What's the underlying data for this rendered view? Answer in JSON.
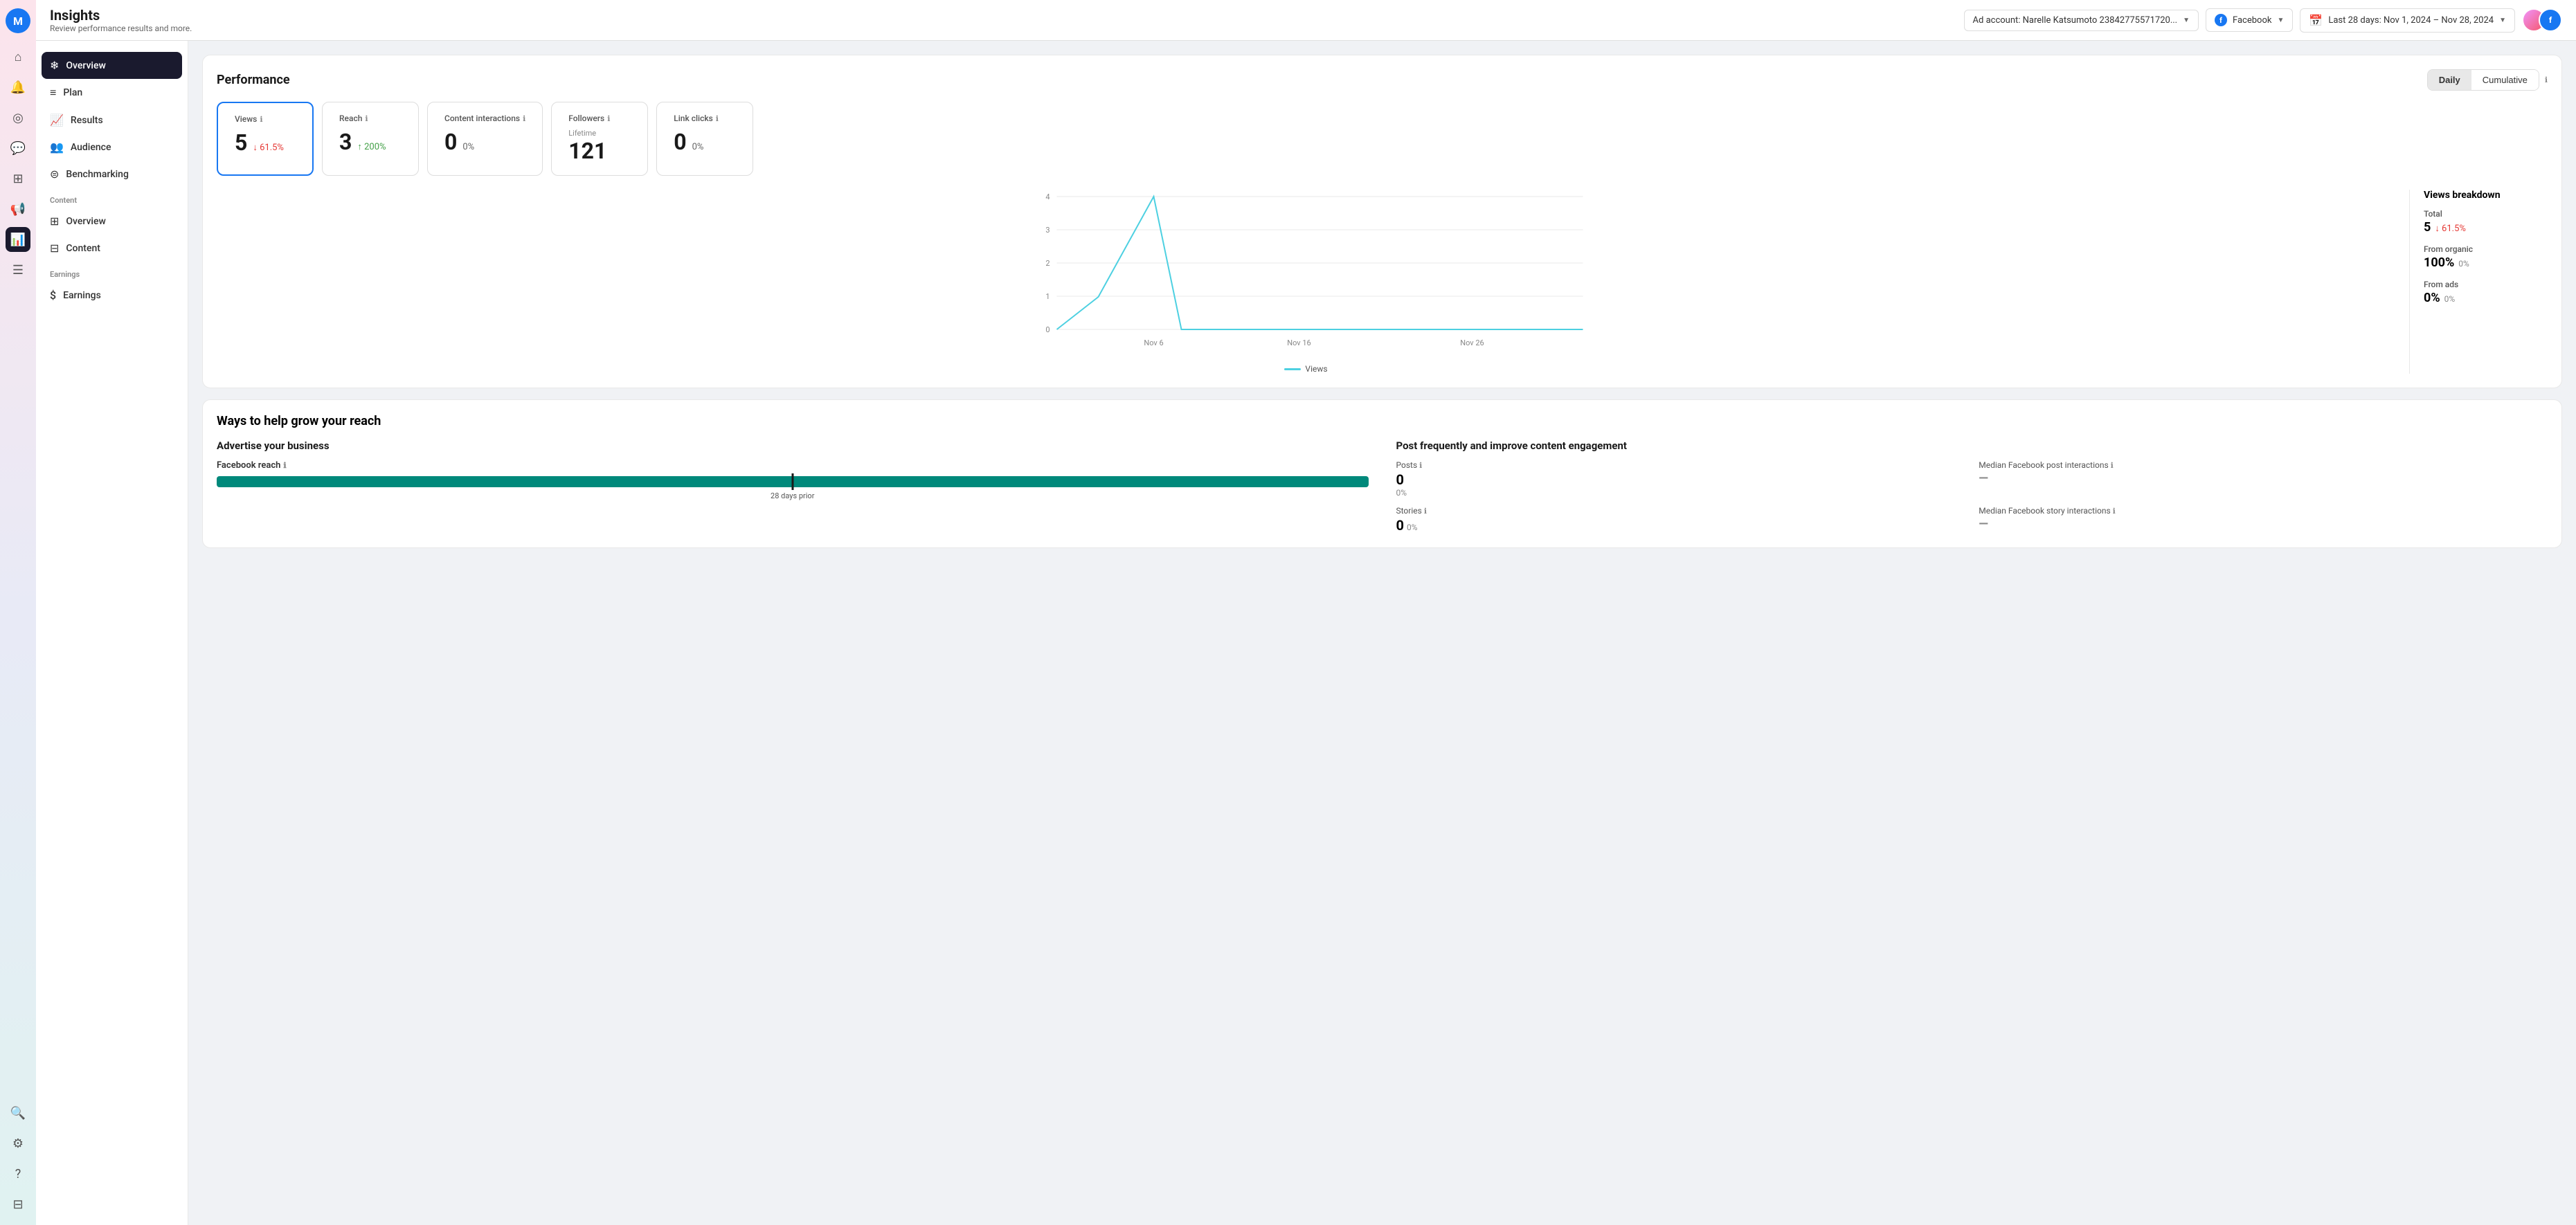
{
  "app": {
    "logo": "M",
    "title": "Insights",
    "subtitle": "Review performance results and more."
  },
  "header": {
    "ad_account_label": "Ad account: Narelle Katsumoto 23842775571720...",
    "platform_label": "Facebook",
    "date_range_label": "Last 28 days: Nov 1, 2024 – Nov 28, 2024"
  },
  "nav": {
    "icons": [
      {
        "name": "home-icon",
        "symbol": "⌂",
        "active": false
      },
      {
        "name": "bell-icon",
        "symbol": "🔔",
        "active": false
      },
      {
        "name": "activity-icon",
        "symbol": "◎",
        "active": false
      },
      {
        "name": "comment-icon",
        "symbol": "💬",
        "active": false
      },
      {
        "name": "grid-icon",
        "symbol": "⊞",
        "active": false
      },
      {
        "name": "megaphone-icon",
        "symbol": "📢",
        "active": false
      },
      {
        "name": "chart-icon",
        "symbol": "📊",
        "active": true
      },
      {
        "name": "menu-icon",
        "symbol": "☰",
        "active": false
      },
      {
        "name": "search-icon",
        "symbol": "🔍",
        "active": false
      },
      {
        "name": "gear-icon",
        "symbol": "⚙",
        "active": false
      },
      {
        "name": "help-icon",
        "symbol": "?",
        "active": false
      },
      {
        "name": "sidebar-toggle-icon",
        "symbol": "⊟",
        "active": false
      }
    ]
  },
  "sidebar": {
    "items": [
      {
        "name": "overview",
        "label": "Overview",
        "icon": "❄",
        "active": true,
        "section": null
      },
      {
        "name": "plan",
        "label": "Plan",
        "icon": "≡",
        "active": false,
        "section": null
      },
      {
        "name": "results",
        "label": "Results",
        "icon": "📈",
        "active": false,
        "section": null
      },
      {
        "name": "audience",
        "label": "Audience",
        "icon": "👥",
        "active": false,
        "section": null
      },
      {
        "name": "benchmarking",
        "label": "Benchmarking",
        "icon": "⊜",
        "active": false,
        "section": null
      },
      {
        "name": "content-overview",
        "label": "Overview",
        "icon": "⊞",
        "active": false,
        "section": "Content"
      },
      {
        "name": "content",
        "label": "Content",
        "icon": "⊟",
        "active": false,
        "section": null
      },
      {
        "name": "earnings",
        "label": "Earnings",
        "icon": "$",
        "active": false,
        "section": "Earnings"
      }
    ]
  },
  "performance": {
    "title": "Performance",
    "toggle": {
      "options": [
        "Daily",
        "Cumulative"
      ],
      "active": "Daily"
    },
    "metrics": [
      {
        "id": "views",
        "label": "Views",
        "value": "5",
        "change": "61.5%",
        "change_dir": "down",
        "selected": true
      },
      {
        "id": "reach",
        "label": "Reach",
        "value": "3",
        "change": "200%",
        "change_dir": "up",
        "selected": false
      },
      {
        "id": "content-interactions",
        "label": "Content interactions",
        "value": "0",
        "change": "0%",
        "change_dir": "neutral",
        "selected": false
      },
      {
        "id": "followers",
        "label": "Followers",
        "value": "121",
        "change": "",
        "change_dir": "neutral",
        "lifetime": "Lifetime",
        "selected": false
      },
      {
        "id": "link-clicks",
        "label": "Link clicks",
        "value": "0",
        "change": "0%",
        "change_dir": "neutral",
        "selected": false
      }
    ],
    "chart": {
      "x_labels": [
        "Nov 6",
        "Nov 16",
        "Nov 26"
      ],
      "y_labels": [
        "0",
        "1",
        "2",
        "3",
        "4"
      ],
      "legend": "Views"
    },
    "breakdown": {
      "title": "Views breakdown",
      "total_label": "Total",
      "total_value": "5",
      "total_change": "61.5%",
      "total_change_dir": "down",
      "organic_label": "From organic",
      "organic_value": "100%",
      "organic_change": "0%",
      "ads_label": "From ads",
      "ads_value": "0%",
      "ads_change": "0%"
    }
  },
  "grow_reach": {
    "title": "Ways to help grow your reach",
    "advertise": {
      "title": "Advertise your business",
      "fb_reach_label": "Facebook reach",
      "bar_label": "28 days prior"
    },
    "post_frequently": {
      "title": "Post frequently and improve content engagement",
      "posts_label": "Posts",
      "posts_value": "0",
      "posts_change": "0%",
      "median_post_label": "Median Facebook post interactions",
      "median_post_value": "—",
      "stories_label": "Stories",
      "stories_value": "0",
      "stories_change": "0%",
      "median_story_label": "Median Facebook story interactions",
      "median_story_value": "—"
    }
  }
}
